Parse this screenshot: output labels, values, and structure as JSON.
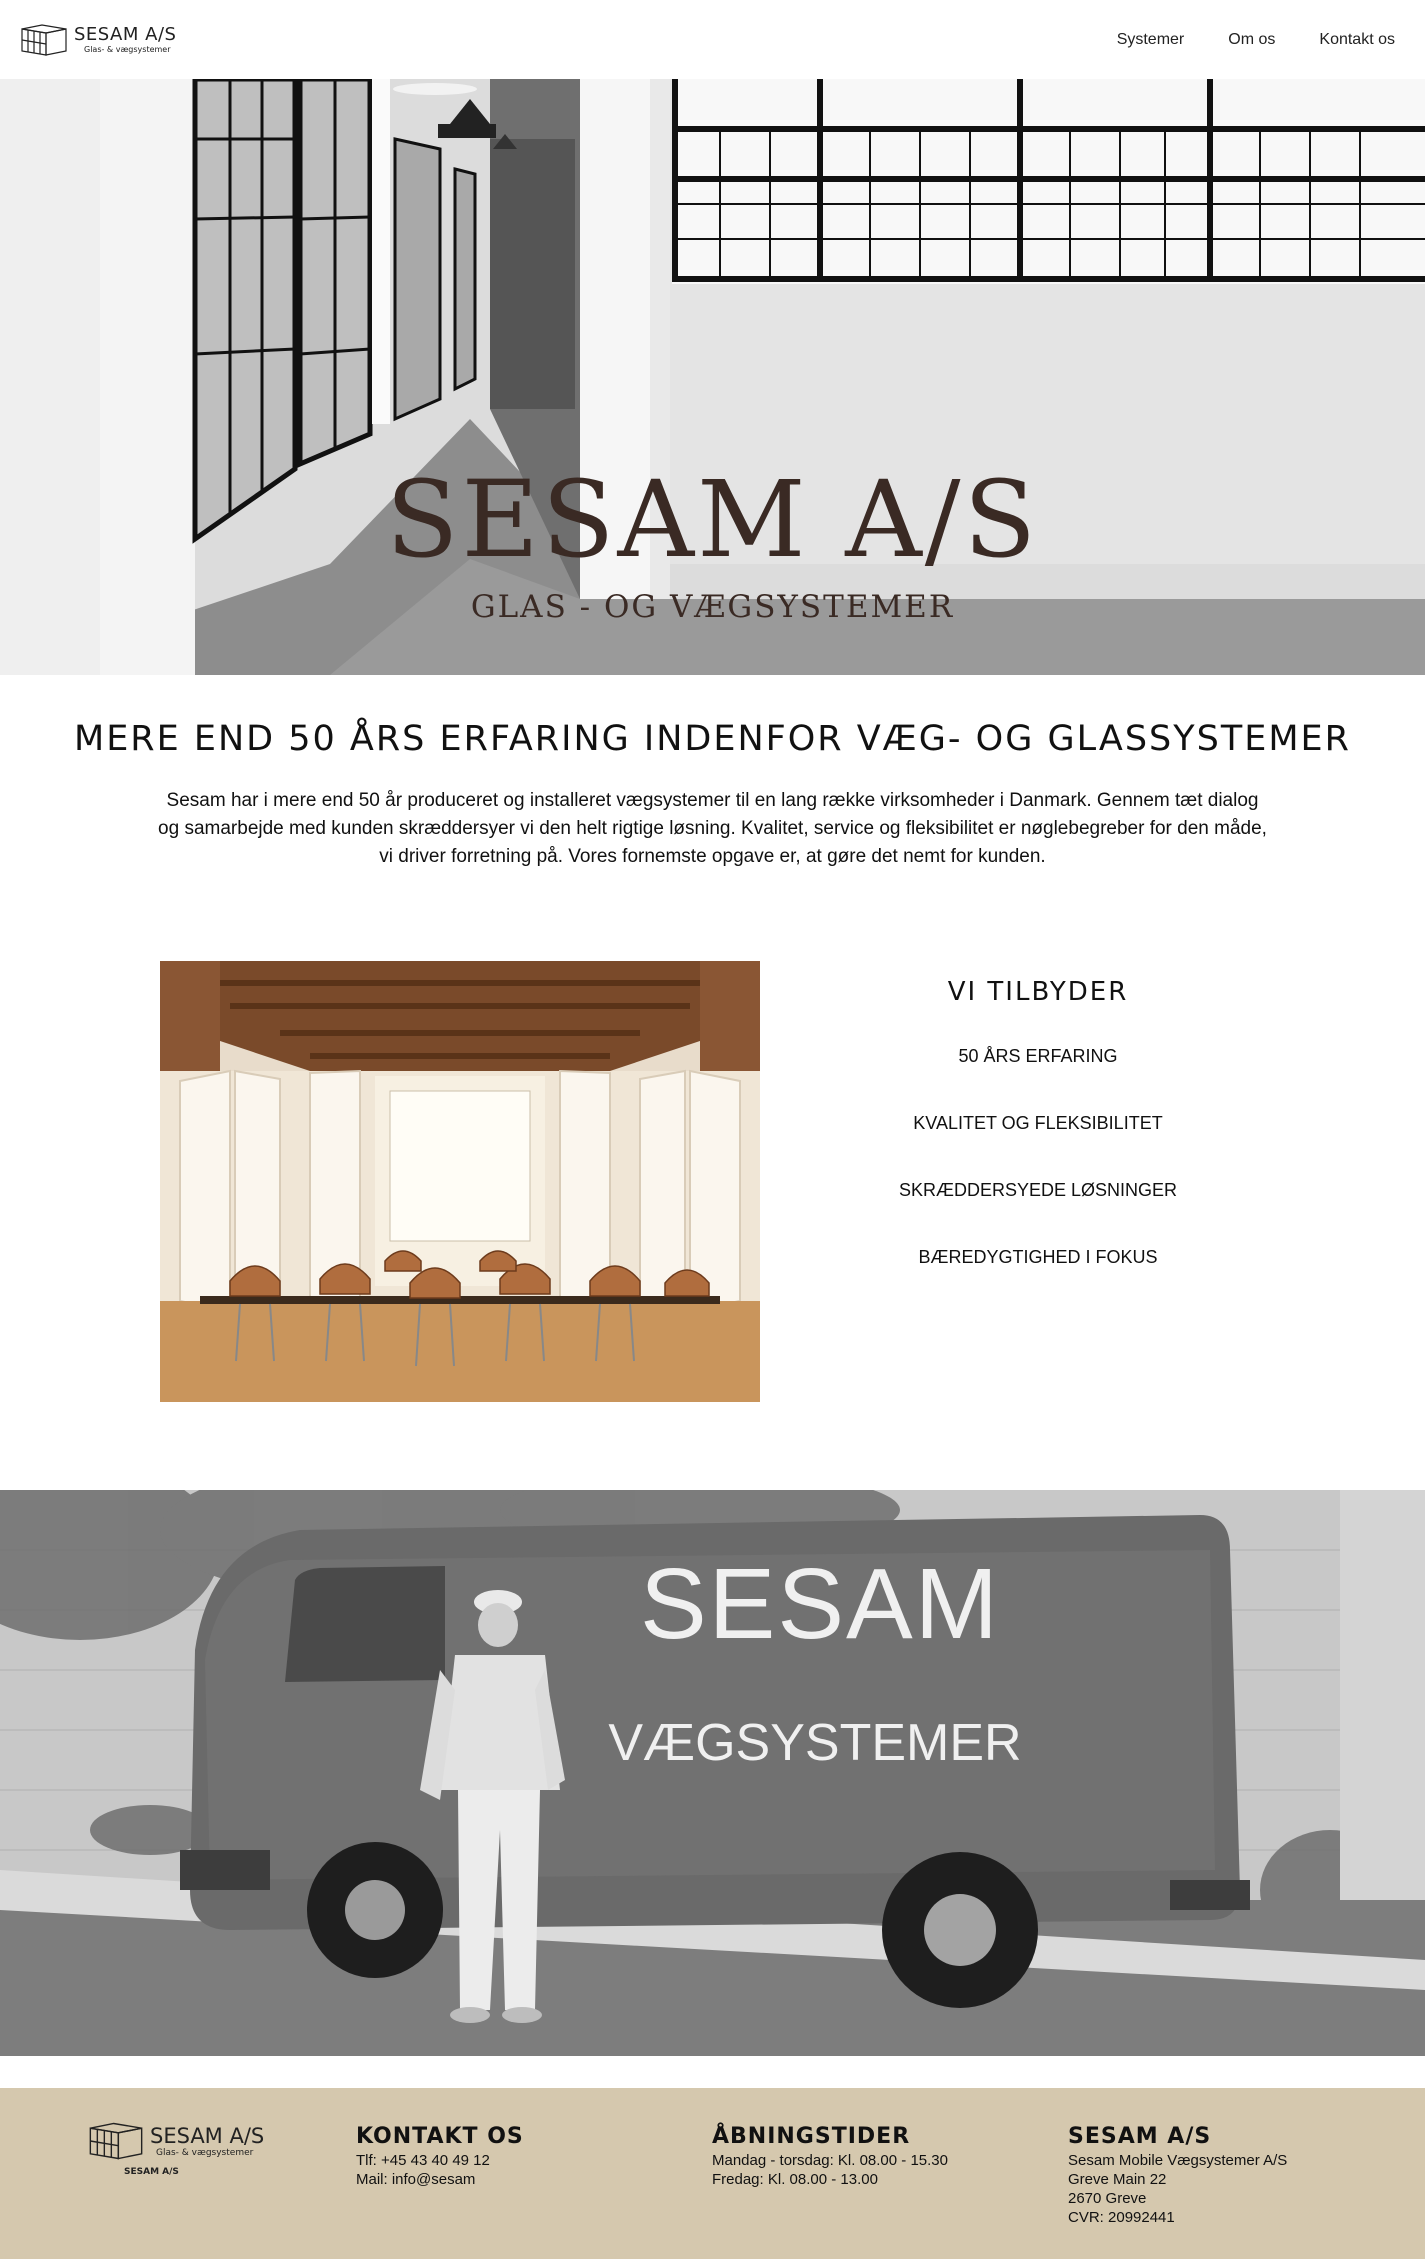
{
  "header": {
    "logo_name": "SESAM A/S",
    "logo_tagline": "Glas- & vægsystemer",
    "nav": [
      "Systemer",
      "Om os",
      "Kontakt os"
    ]
  },
  "hero": {
    "title": "SESAM A/S",
    "subtitle": "GLAS - OG VÆGSYSTEMER"
  },
  "intro": {
    "heading": "MERE END 50 ÅRS ERFARING INDENFOR VÆG- OG GLASSYSTEMER",
    "body": "Sesam har i mere end 50 år produceret og installeret vægsystemer til en lang række virksomheder i Danmark. Gennem tæt dialog og samarbejde med kunden skræddersyer vi den helt rigtige løsning. Kvalitet, service og fleksibilitet er nøglebegreber for den måde, vi driver forretning på. Vores fornemste opgave er, at gøre det nemt for kunden."
  },
  "offer": {
    "heading": "VI TILBYDER",
    "items": [
      "50 ÅRS ERFARING",
      "KVALITET OG FLEKSIBILITET",
      "SKRÆDDERSYEDE LØSNINGER",
      "BÆREDYGTIGHED I FOKUS"
    ]
  },
  "van_photo": {
    "van_text_1": "SESAM",
    "van_text_2": "VÆGSYSTEMER"
  },
  "footer": {
    "logo_name": "SESAM A/S",
    "logo_tagline": "Glas- & vægsystemer",
    "logo_under": "SESAM A/S",
    "contact": {
      "heading": "KONTAKT OS",
      "lines": [
        "Tlf: +45 43 40 49 12",
        "Mail: info@sesam"
      ]
    },
    "hours": {
      "heading": "ÅBNINGSTIDER",
      "lines": [
        "Mandag - torsdag: Kl. 08.00 - 15.30",
        "Fredag: Kl. 08.00 - 13.00"
      ]
    },
    "company": {
      "heading": "SESAM A/S",
      "lines": [
        "Sesam Mobile Vægsystemer A/S",
        "Greve Main 22",
        "2670 Greve",
        "CVR: 20992441"
      ]
    }
  },
  "colors": {
    "hero_title": "#3a2a24",
    "footer_bg": "#d5c8ae"
  },
  "icons": [
    "cube-logo-icon"
  ]
}
